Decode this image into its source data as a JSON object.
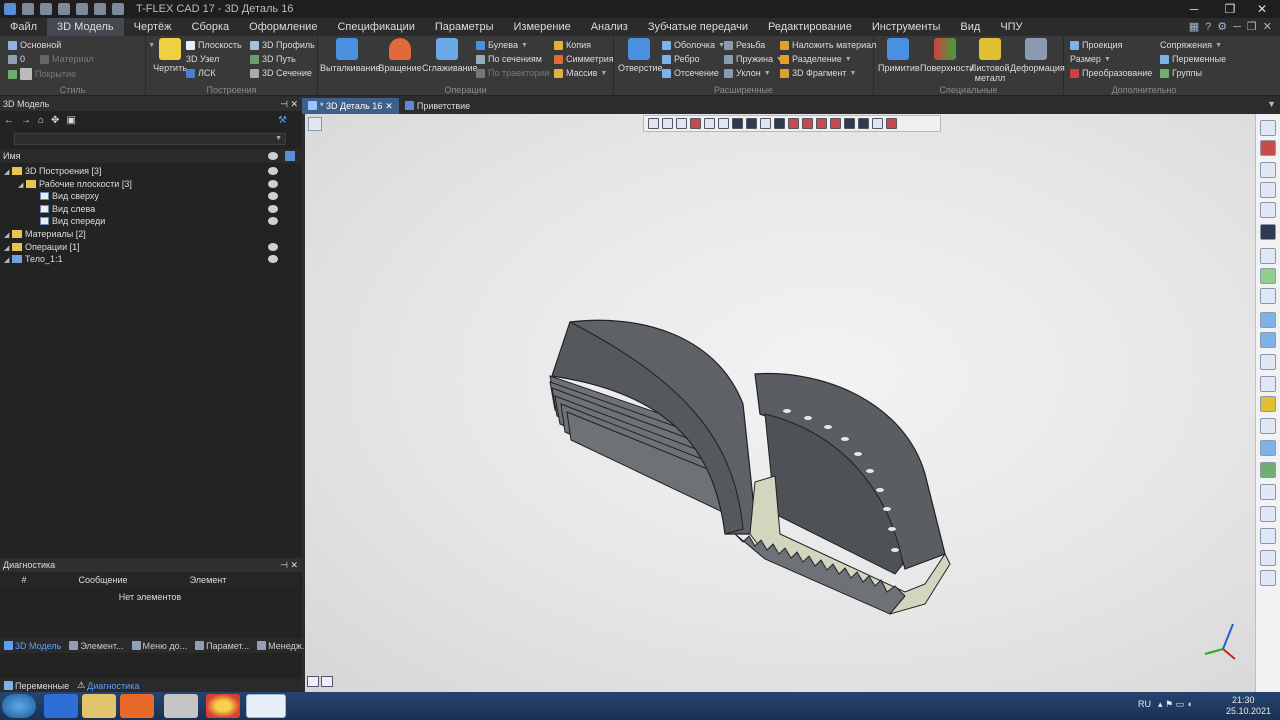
{
  "window": {
    "title": "T-FLEX CAD 17 - 3D Деталь 16"
  },
  "menu": [
    "Файл",
    "3D Модель",
    "Чертёж",
    "Сборка",
    "Оформление",
    "Спецификации",
    "Параметры",
    "Измерение",
    "Анализ",
    "Зубчатые передачи",
    "Редактирование",
    "Инструменты",
    "Вид",
    "ЧПУ"
  ],
  "menu_active": "3D Модель",
  "ribbon": {
    "style": {
      "label": "Стиль",
      "layer": "Основной",
      "material": "Материал",
      "level": "0",
      "coating": "Покрытие"
    },
    "build": {
      "label": "Построения",
      "draw": "Чертить",
      "plane": "Плоскость",
      "node": "3D Узел",
      "lcs": "ЛСК",
      "profile": "3D Профиль",
      "path": "3D Путь",
      "section": "3D Сечение"
    },
    "ops": {
      "label": "Операции",
      "extrude": "Выталкивание",
      "rotate": "Вращение",
      "smooth": "Сглаживание",
      "bool": "Булева",
      "sections": "По сечениям",
      "trajectory": "По траектории",
      "copy": "Копия",
      "symmetry": "Симметрия",
      "array": "Массив"
    },
    "ext": {
      "label": "Расширенные",
      "hole": "Отверстие",
      "shell": "Оболочка",
      "rib": "Ребро",
      "cut": "Отсечение",
      "thread": "Резьба",
      "spring": "Пружина",
      "slope": "Уклон",
      "apply_mat": "Наложить материал",
      "split": "Разделение",
      "fragment": "3D Фрагмент"
    },
    "spec": {
      "label": "Специальные",
      "primitives": "Примитив",
      "surfaces": "Поверхности",
      "sheet": "Листовой металл",
      "deform": "Деформация"
    },
    "extra": {
      "label": "Дополнительно",
      "projection": "Проекция",
      "size": "Размер",
      "transform": "Преобразование",
      "constraints": "Сопряжения",
      "variables": "Переменные",
      "groups": "Группы"
    }
  },
  "model_panel": {
    "title": "3D Модель",
    "col_name": "Имя",
    "tree": [
      {
        "label": "3D Построения [3]",
        "indent": 0,
        "icon": "folder",
        "eye": true
      },
      {
        "label": "Рабочие плоскости [3]",
        "indent": 1,
        "icon": "folder",
        "eye": true
      },
      {
        "label": "Вид сверху",
        "indent": 2,
        "icon": "view",
        "eye": true
      },
      {
        "label": "Вид слева",
        "indent": 2,
        "icon": "view",
        "eye": true
      },
      {
        "label": "Вид спереди",
        "indent": 2,
        "icon": "view",
        "eye": true
      },
      {
        "label": "Материалы [2]",
        "indent": 0,
        "icon": "folder",
        "eye": false
      },
      {
        "label": "Операции [1]",
        "indent": 0,
        "icon": "folder",
        "eye": true
      },
      {
        "label": "Тело_1:1",
        "indent": 0,
        "icon": "body",
        "eye": true
      }
    ]
  },
  "panel_tabs": [
    "3D Модель",
    "Элемент...",
    "Меню до...",
    "Парамет...",
    "Менедж..."
  ],
  "diagnostics": {
    "title": "Диагностика",
    "cols": [
      "#",
      "Сообщение",
      "Элемент"
    ],
    "empty": "Нет элементов"
  },
  "bottom_tabs": [
    "Переменные",
    "Диагностика"
  ],
  "doc_tabs": [
    "* 3D Деталь 16",
    "Приветствие"
  ],
  "tray": {
    "lang": "RU",
    "time": "21:30",
    "date": "25.10.2021"
  },
  "colors": {
    "accent": "#3d5f8a",
    "model": "#5e6166",
    "model_section": "#d2d6bf"
  }
}
